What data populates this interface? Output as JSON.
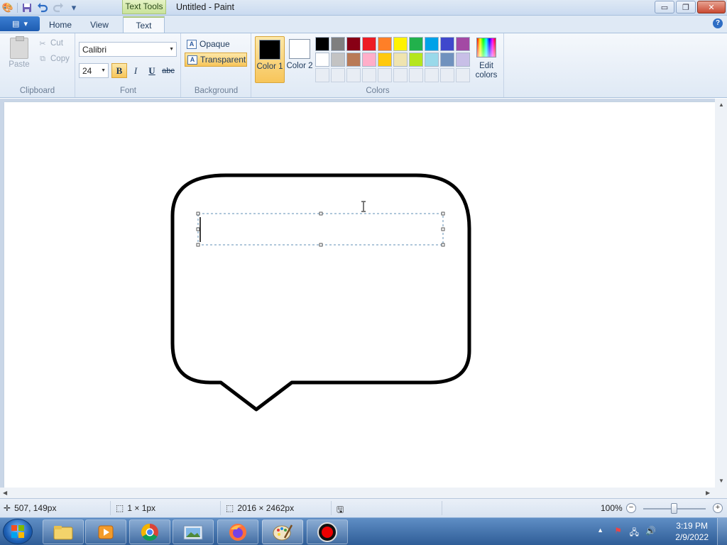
{
  "window": {
    "title": "Untitled - Paint",
    "context_tab": "Text Tools",
    "controls": {
      "minimize": "▭",
      "restore": "❐",
      "close": "✕"
    }
  },
  "tabs": {
    "home": "Home",
    "view": "View",
    "text": "Text",
    "active": "Text"
  },
  "clipboard": {
    "paste": "Paste",
    "cut": "Cut",
    "copy": "Copy",
    "label": "Clipboard"
  },
  "font": {
    "name": "Calibri",
    "size": "24",
    "bold": "B",
    "italic": "I",
    "underline": "U",
    "strike": "abc",
    "label": "Font",
    "bold_active": true
  },
  "background": {
    "opaque": "Opaque",
    "transparent": "Transparent",
    "label": "Background",
    "selected": "Transparent"
  },
  "colors": {
    "label": "Colors",
    "color1": {
      "label": "Color 1",
      "value": "#000000"
    },
    "color2": {
      "label": "Color 2",
      "value": "#ffffff"
    },
    "edit": "Edit colors",
    "palette_row1": [
      "#000000",
      "#7f7f7f",
      "#880015",
      "#ed1c24",
      "#ff7f27",
      "#fff200",
      "#22b14c",
      "#00a2e8",
      "#3f48cc",
      "#a349a4"
    ],
    "palette_row2": [
      "#ffffff",
      "#c3c3c3",
      "#b97a57",
      "#ffaec9",
      "#ffc90e",
      "#efe4b0",
      "#b5e61d",
      "#99d9ea",
      "#7092be",
      "#c8bfe7"
    ]
  },
  "canvas": {
    "background": "#ffffff",
    "shape": "speech-bubble",
    "text_box_active": true
  },
  "status": {
    "cursor": "507, 149px",
    "selection": "1 × 1px",
    "image_size": "2016 × 2462px",
    "zoom": "100%",
    "zoom_percent": 100
  },
  "taskbar": {
    "apps": [
      "file-explorer",
      "media-player",
      "chrome",
      "photo-viewer",
      "firefox",
      "paint",
      "recorder"
    ],
    "time": "3:19 PM",
    "date": "2/9/2022"
  }
}
